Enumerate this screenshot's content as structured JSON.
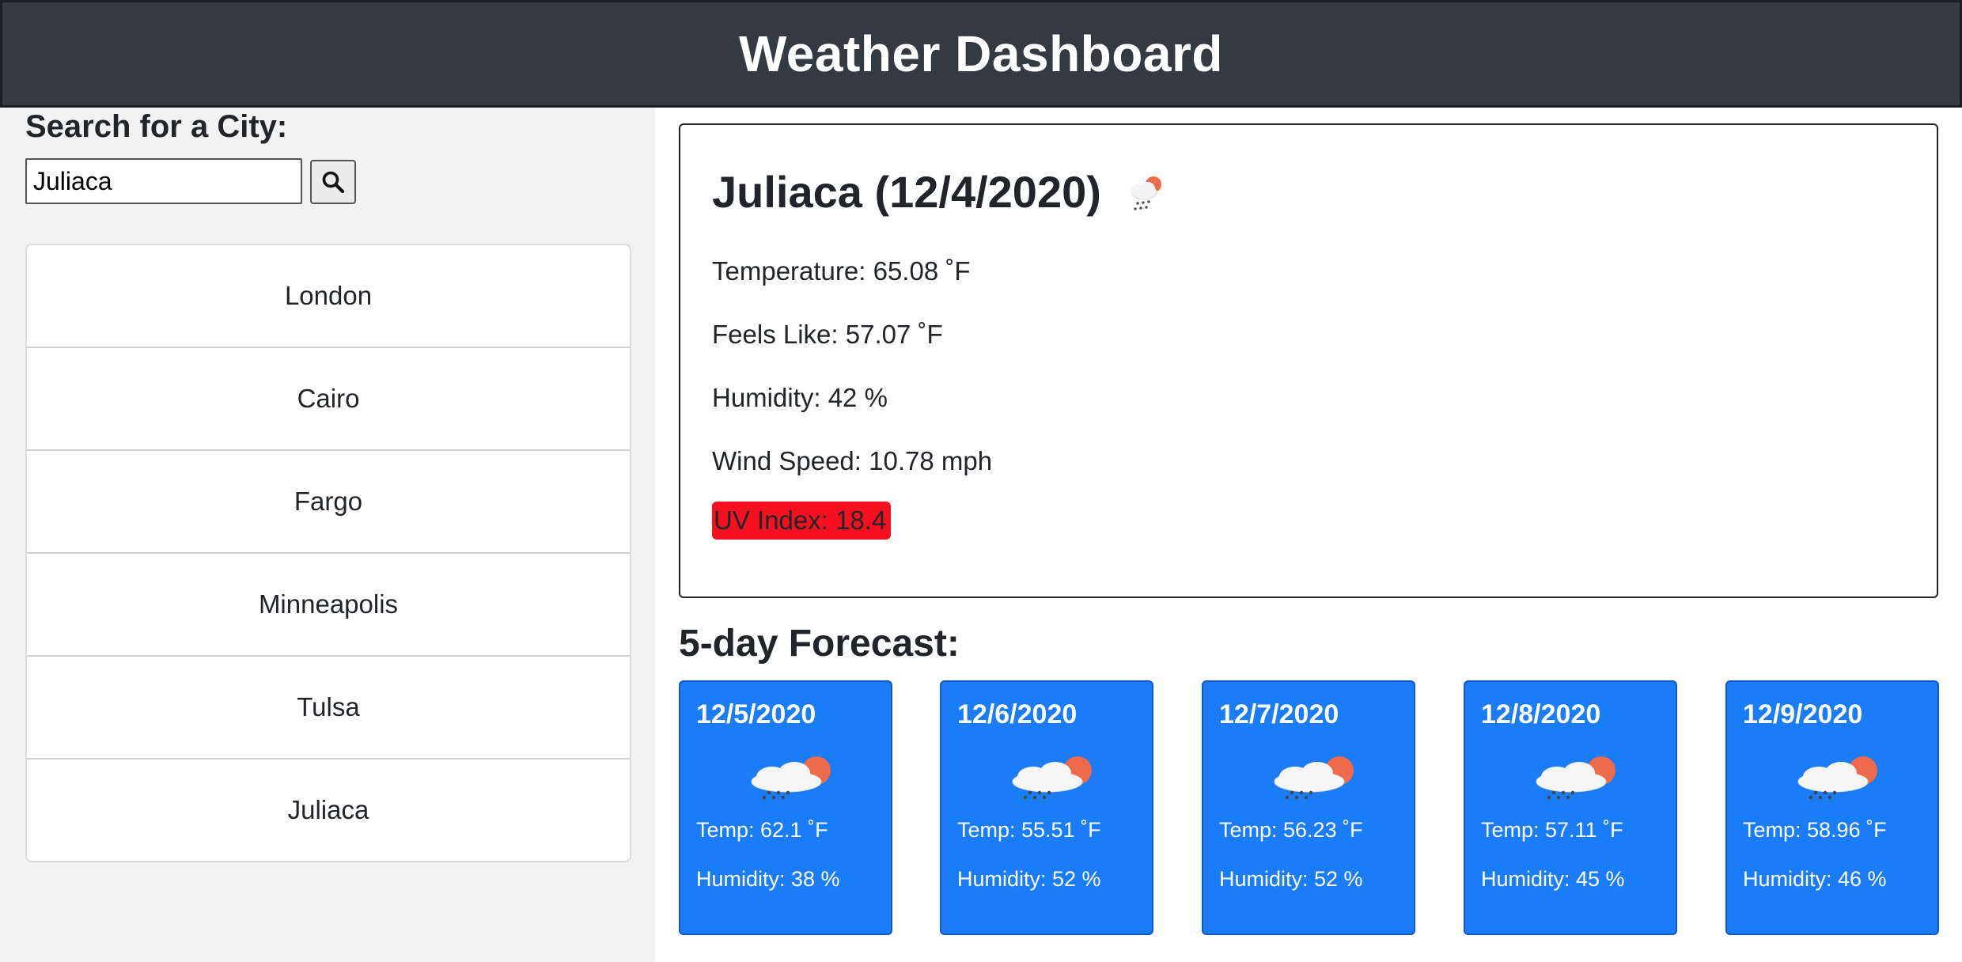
{
  "header": {
    "title": "Weather Dashboard"
  },
  "sidebar": {
    "search_label": "Search for a City:",
    "search_value": "Juliaca",
    "search_icon": "search-icon",
    "cities": [
      "London",
      "Cairo",
      "Fargo",
      "Minneapolis",
      "Tulsa",
      "Juliaca"
    ]
  },
  "current": {
    "title": "Juliaca (12/4/2020)",
    "icon": "light-rain-icon",
    "temperature": "Temperature: 65.08 ˚F",
    "feels_like": "Feels Like: 57.07 ˚F",
    "humidity": "Humidity: 42 %",
    "wind_speed": "Wind Speed: 10.78 mph",
    "uv_index": "UV Index: 18.4",
    "uv_color": "#f5101f"
  },
  "forecast": {
    "heading": "5-day Forecast:",
    "card_color": "#1a7cf6",
    "days": [
      {
        "date": "12/5/2020",
        "icon": "light-rain-icon",
        "temp": "Temp: 62.1 ˚F",
        "humidity": "Humidity: 38 %"
      },
      {
        "date": "12/6/2020",
        "icon": "light-rain-icon",
        "temp": "Temp: 55.51 ˚F",
        "humidity": "Humidity: 52 %"
      },
      {
        "date": "12/7/2020",
        "icon": "light-rain-icon",
        "temp": "Temp: 56.23 ˚F",
        "humidity": "Humidity: 52 %"
      },
      {
        "date": "12/8/2020",
        "icon": "light-rain-icon",
        "temp": "Temp: 57.11 ˚F",
        "humidity": "Humidity: 45 %"
      },
      {
        "date": "12/9/2020",
        "icon": "light-rain-icon",
        "temp": "Temp: 58.96 ˚F",
        "humidity": "Humidity: 46 %"
      }
    ]
  }
}
